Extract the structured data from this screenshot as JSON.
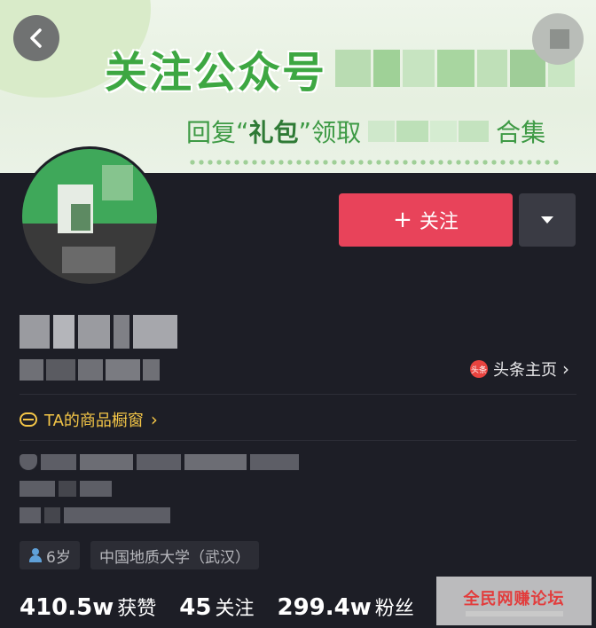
{
  "banner": {
    "title_prefix": "关注公众号",
    "subtitle_prefix": "回复",
    "subtitle_quote_open": "“",
    "subtitle_keyword": "礼包",
    "subtitle_quote_close": "”",
    "subtitle_middle": "领取",
    "subtitle_suffix": "合集"
  },
  "actions": {
    "follow_label": "关注",
    "follow_plus": "+"
  },
  "profile": {
    "toutiao_icon_text": "头条",
    "toutiao_label": "头条主页",
    "toutiao_chevron": "›",
    "shop_label": "TA的商品橱窗",
    "shop_chevron": "›",
    "tags": {
      "age": "6岁",
      "school": "中国地质大学（武汉）"
    }
  },
  "stats": [
    {
      "value": "410.5w",
      "label": "获赞"
    },
    {
      "value": "45",
      "label": "关注"
    },
    {
      "value": "299.4w",
      "label": "粉丝"
    }
  ],
  "watermark": {
    "text": "全民网赚论坛"
  },
  "colors": {
    "accent": "#e8435a",
    "shop": "#f3c547",
    "banner_green": "#3da742"
  }
}
